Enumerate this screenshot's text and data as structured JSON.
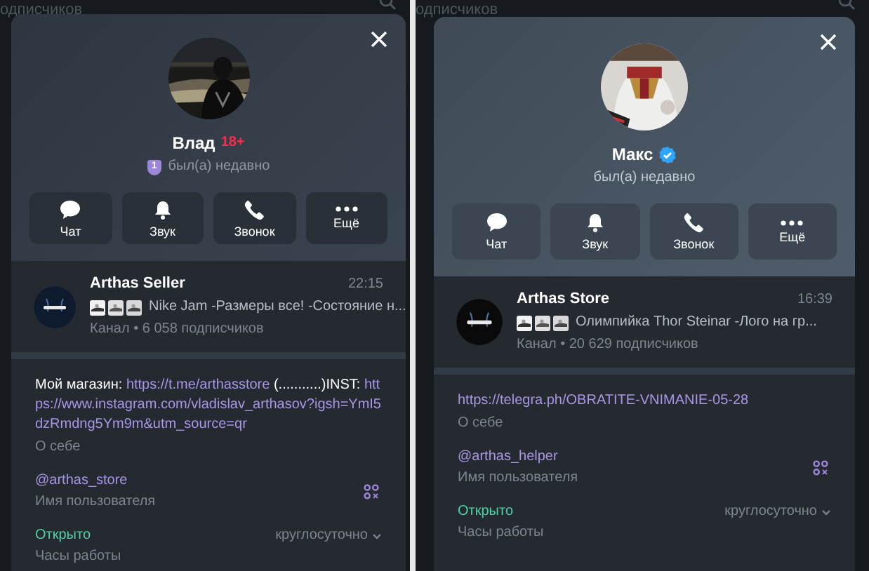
{
  "panels": [
    {
      "backdrop_text": "одписчиков",
      "name": "Влад",
      "name_badge": "18+",
      "status_badge": "1",
      "status": "был(а) недавно",
      "actions": [
        {
          "kind": "chat",
          "label": "Чат"
        },
        {
          "kind": "bell",
          "label": "Звук"
        },
        {
          "kind": "phone",
          "label": "Звонок"
        },
        {
          "kind": "more",
          "label": "Ещё"
        }
      ],
      "channel": {
        "title": "Arthas Seller",
        "time": "22:15",
        "preview": "Nike Jam -Размеры все! -Состояние н...",
        "meta": "Канал • 6 058 подписчиков"
      },
      "bio": [
        {
          "kind": "text",
          "text": "Мой магазин: "
        },
        {
          "kind": "link",
          "text": "https://t.me/arthasstore"
        },
        {
          "kind": "text",
          "text": " (...........)INST: "
        },
        {
          "kind": "link",
          "text": "https://www.instagram.com/vladislav_arthasov?igsh=YmI5dzRmdng5Ym9m&utm_source=qr"
        }
      ],
      "bio_label": "О себе",
      "username": "@arthas_store",
      "username_label": "Имя пользователя",
      "hours": {
        "status": "Открыто",
        "value": "круглосуточно",
        "label": "Часы работы"
      }
    },
    {
      "backdrop_text": "одписчиков",
      "name": "Макс",
      "verified": true,
      "status": "был(а) недавно",
      "actions": [
        {
          "kind": "chat",
          "label": "Чат"
        },
        {
          "kind": "bell",
          "label": "Звук"
        },
        {
          "kind": "phone",
          "label": "Звонок"
        },
        {
          "kind": "more",
          "label": "Ещё"
        }
      ],
      "channel": {
        "title": "Arthas Store",
        "time": "16:39",
        "preview": "Олимпийка Thor Steinar  -Лого на гр...",
        "meta": "Канал • 20 629 подписчиков"
      },
      "bio": [
        {
          "kind": "link",
          "text": "https://telegra.ph/OBRATITE-VNIMANIE-05-28"
        }
      ],
      "bio_label": "О себе",
      "username": "@arthas_helper",
      "username_label": "Имя пользователя",
      "hours": {
        "status": "Открыто",
        "value": "круглосуточно",
        "label": "Часы работы"
      }
    }
  ]
}
